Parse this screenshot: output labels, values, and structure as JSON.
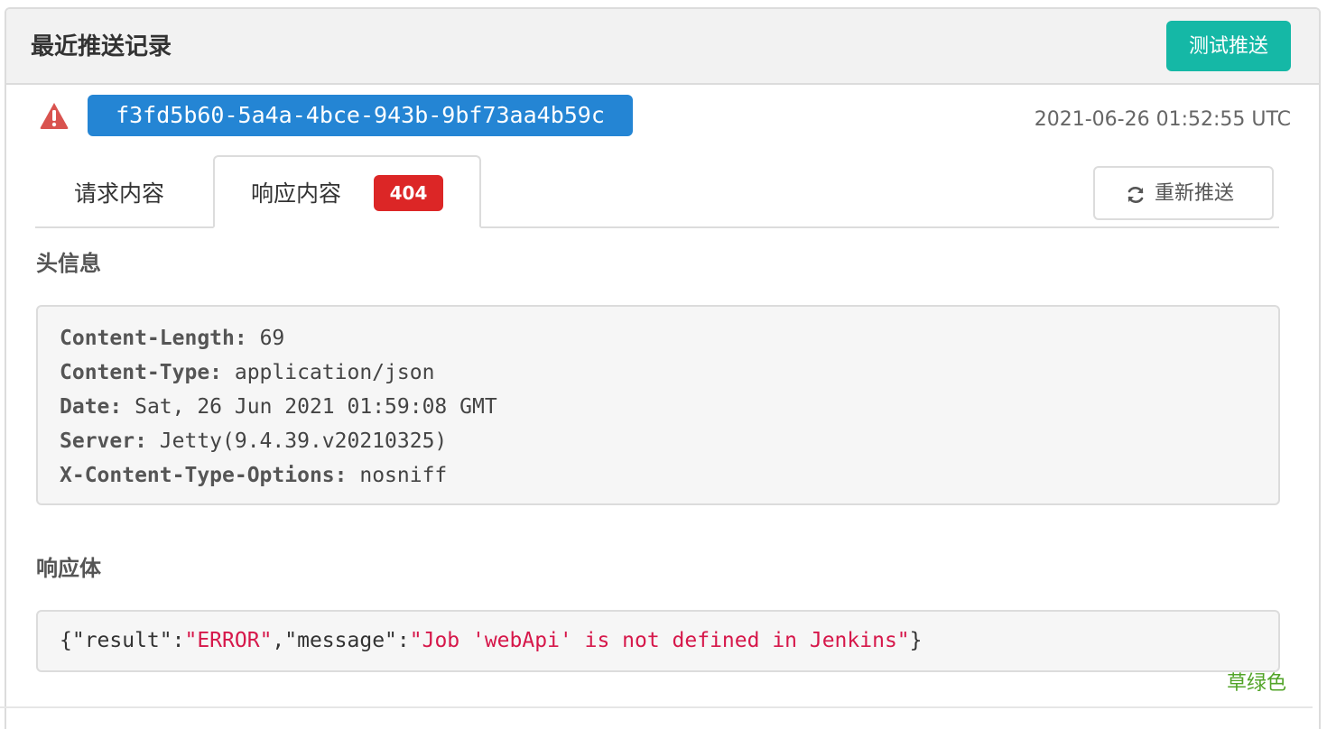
{
  "panel": {
    "title": "最近推送记录",
    "test_button_label": "测试推送"
  },
  "delivery": {
    "status_icon": "warning-triangle-icon",
    "id": "f3fd5b60-5a4a-4bce-943b-9bf73aa4b59c",
    "timestamp": "2021-06-26 01:52:55 UTC"
  },
  "tabs": [
    {
      "label": "请求内容",
      "active": false
    },
    {
      "label": "响应内容",
      "active": true,
      "badge": "404"
    }
  ],
  "resend_button": {
    "icon": "refresh-icon",
    "label": "重新推送"
  },
  "response": {
    "headers_title": "头信息",
    "headers": [
      {
        "key": "Content-Length:",
        "value": " 69"
      },
      {
        "key": "Content-Type:",
        "value": " application/json"
      },
      {
        "key": "Date:",
        "value": " Sat, 26 Jun 2021 01:59:08 GMT"
      },
      {
        "key": "Server:",
        "value": " Jetty(9.4.39.v20210325)"
      },
      {
        "key": "X-Content-Type-Options:",
        "value": " nosniff"
      }
    ],
    "body_title": "响应体",
    "body_tokens": [
      {
        "text": "{\"result\":",
        "kind": "punct"
      },
      {
        "text": "\"ERROR\"",
        "kind": "str"
      },
      {
        "text": ",\"message\":",
        "kind": "punct"
      },
      {
        "text": "\"Job 'webApi' is not defined in Jenkins\"",
        "kind": "str"
      },
      {
        "text": "}",
        "kind": "punct"
      }
    ]
  },
  "theme_label": "草绿色",
  "colors": {
    "accent_teal": "#15b8a6",
    "id_badge_blue": "#2485d4",
    "status_red": "#dc2626",
    "warning_red": "#d9534f",
    "json_string": "#d6174a",
    "theme_green": "#52a428"
  }
}
